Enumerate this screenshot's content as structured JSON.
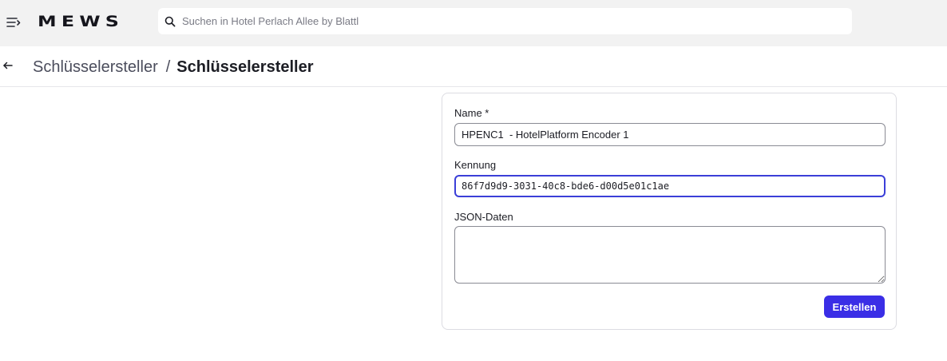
{
  "app": {
    "logo": "MEWS"
  },
  "search": {
    "placeholder": "Suchen in Hotel Perlach Allee by Blattl"
  },
  "breadcrumb": {
    "parent": "Schlüsselersteller",
    "separator": "/",
    "current": "Schlüsselersteller"
  },
  "form": {
    "name_label": "Name *",
    "name_value": "HPENC1  - HotelPlatform Encoder 1",
    "id_label": "Kennung",
    "id_value": "86f7d9d9-3031-40c8-bde6-d00d5e01c1ae",
    "json_label": "JSON-Daten",
    "json_value": "",
    "submit_label": "Erstellen"
  },
  "colors": {
    "accent": "#3a2ee6",
    "focus": "#3b3fd8",
    "topbar": "#f2f2f2"
  },
  "icons": {
    "menu": "menu-icon",
    "search": "search-icon",
    "back": "arrow-left-icon"
  }
}
